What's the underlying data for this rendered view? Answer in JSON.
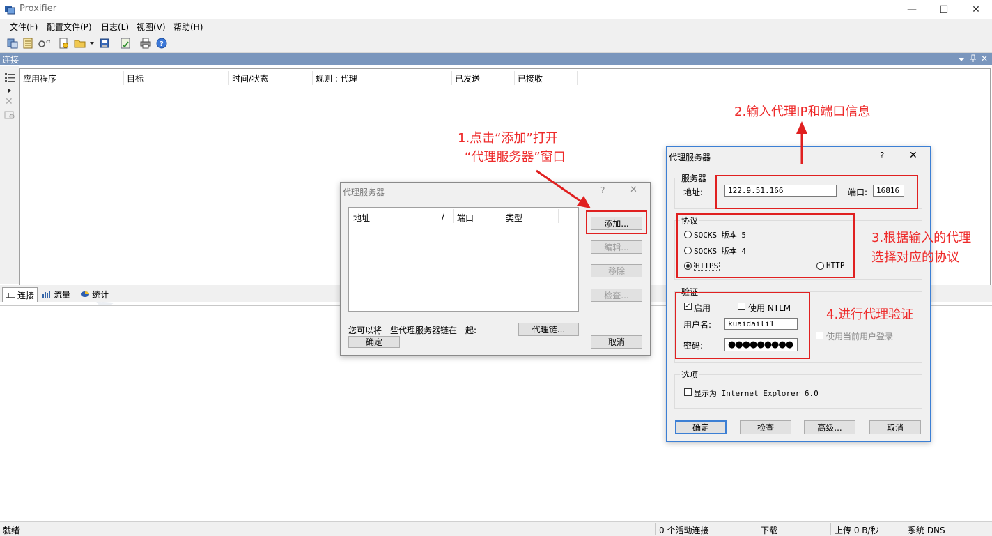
{
  "window": {
    "title": "Proxifier",
    "minimize": "—",
    "maximize": "☐",
    "close": "✕"
  },
  "menu": [
    "文件(F)",
    "配置文件(P)",
    "日志(L)",
    "视图(V)",
    "帮助(H)"
  ],
  "connections": {
    "title": "连接",
    "columns": [
      "应用程序",
      "目标",
      "时间/状态",
      "规则 : 代理",
      "已发送",
      "已接收"
    ]
  },
  "tabs": [
    "连接",
    "流量",
    "统计"
  ],
  "status": {
    "ready": "就绪",
    "active": "0 个活动连接",
    "download": "下载",
    "upload": "上传 0 B/秒",
    "dns": "系统 DNS"
  },
  "proxy_list_dialog": {
    "title": "代理服务器",
    "help": "?",
    "close": "✕",
    "columns": [
      "地址",
      "/",
      "端口",
      "类型"
    ],
    "add": "添加...",
    "edit": "编辑...",
    "remove": "移除",
    "check": "检查...",
    "chain_text": "您可以将一些代理服务器链在一起:",
    "chain_button": "代理链...",
    "ok": "确定",
    "cancel": "取消"
  },
  "proxy_edit_dialog": {
    "title": "代理服务器",
    "help": "?",
    "close": "✕",
    "server_group": "服务器",
    "address_label": "地址:",
    "address_value": "122.9.51.166",
    "port_label": "端口:",
    "port_value": "16816",
    "protocol_group": "协议",
    "socks5": "SOCKS 版本 5",
    "socks4": "SOCKS 版本 4",
    "https": "HTTPS",
    "http": "HTTP",
    "auth_group": "验证",
    "enable": "启用",
    "ntlm": "使用 NTLM",
    "current_user": "使用当前用户登录",
    "username_label": "用户名:",
    "username_value": "kuaidaili1",
    "password_label": "密码:",
    "password_value": "●●●●●●●●●",
    "options_group": "选项",
    "ie_option": "显示为 Internet Explorer 6.0",
    "ok": "确定",
    "check": "检查",
    "advanced": "高级...",
    "cancel": "取消"
  },
  "annotations": {
    "step1_line1": "1.点击“添加”打开",
    "step1_line2": "“代理服务器”窗口",
    "step2": "2.输入代理IP和端口信息",
    "step3_line1": "3.根据输入的代理",
    "step3_line2": "选择对应的协议",
    "step4": "4.进行代理验证"
  },
  "colors": {
    "annotation_red": "#e02020",
    "pane_header": "#7a96bd",
    "default_button": "#3c7fd4"
  }
}
